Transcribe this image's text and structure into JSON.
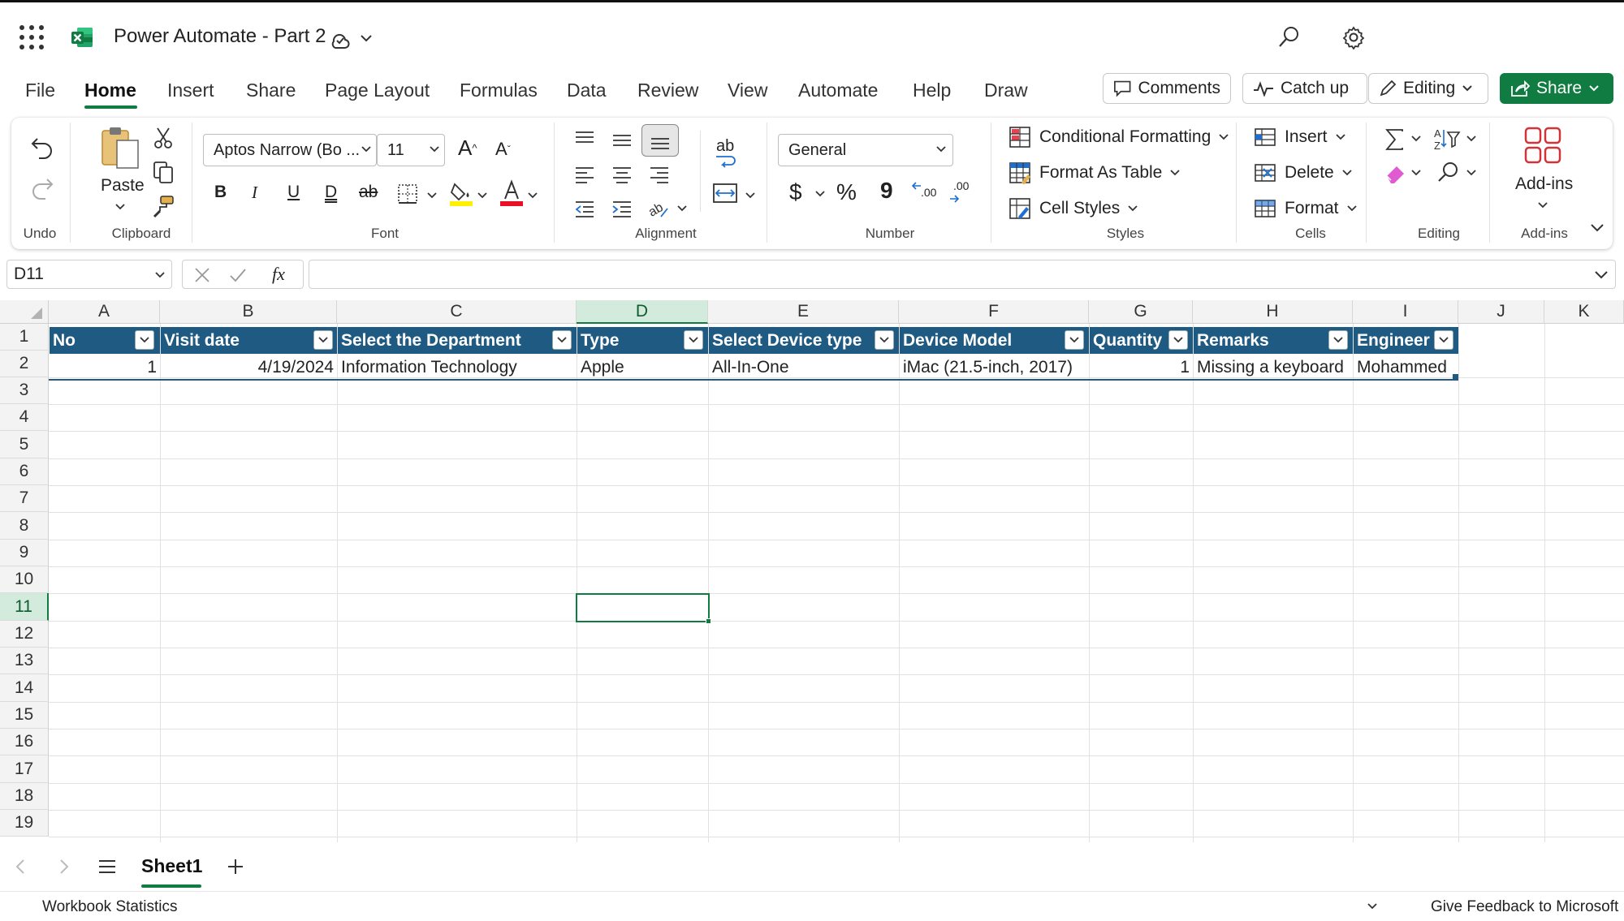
{
  "app": {
    "title": "Power Automate - Part 2"
  },
  "colors": {
    "accent": "#107c41",
    "table_header": "#1f5a82"
  },
  "tabs": [
    {
      "label": "File"
    },
    {
      "label": "Home",
      "active": true
    },
    {
      "label": "Insert"
    },
    {
      "label": "Share"
    },
    {
      "label": "Page Layout"
    },
    {
      "label": "Formulas"
    },
    {
      "label": "Data"
    },
    {
      "label": "Review"
    },
    {
      "label": "View"
    },
    {
      "label": "Automate"
    },
    {
      "label": "Help"
    },
    {
      "label": "Draw"
    }
  ],
  "header_buttons": {
    "comments": "Comments",
    "catchup": "Catch up",
    "editing": "Editing",
    "share": "Share"
  },
  "ribbon": {
    "groups": {
      "undo": "Undo",
      "clipboard": "Clipboard",
      "font": "Font",
      "alignment": "Alignment",
      "number": "Number",
      "styles": "Styles",
      "cells": "Cells",
      "editing": "Editing",
      "addins": "Add-ins"
    },
    "paste_label": "Paste",
    "font_name": "Aptos Narrow (Bo ...",
    "font_size": "11",
    "number_format": "General",
    "conditional_formatting": "Conditional Formatting",
    "format_as_table": "Format As Table",
    "cell_styles": "Cell Styles",
    "insert": "Insert",
    "delete": "Delete",
    "format": "Format",
    "addins_label": "Add-ins",
    "bold_glyph": "B",
    "italic_glyph": "I",
    "underline_glyph": "U",
    "double_underline_glyph": "D",
    "strike_glyph": "ab",
    "dollar_glyph": "$",
    "percent_glyph": "%",
    "comma_glyph": "9",
    "inc_dec_glyph": ".00",
    "dec_dec_glyph": ".00",
    "wrap_glyph": "ab"
  },
  "formula_bar": {
    "name_box": "D11",
    "fx": "fx",
    "value": ""
  },
  "grid": {
    "columns": [
      "A",
      "B",
      "C",
      "D",
      "E",
      "F",
      "G",
      "H",
      "I",
      "J",
      "K"
    ],
    "rows": [
      "1",
      "2",
      "3",
      "4",
      "5",
      "6",
      "7",
      "8",
      "9",
      "10",
      "11",
      "12",
      "13",
      "14",
      "15",
      "16",
      "17",
      "18",
      "19"
    ],
    "selected_col": "D",
    "selected_row": "11"
  },
  "table": {
    "headers": [
      "No",
      "Visit date",
      "Select the Department",
      "Type",
      "Select Device type",
      "Device Model",
      "Quantity",
      "Remarks",
      "Engineer"
    ],
    "rows": [
      [
        "1",
        "4/19/2024",
        "Information Technology",
        "Apple",
        "All-In-One",
        "iMac (21.5-inch, 2017)",
        "1",
        "Missing a keyboard",
        "Mohammed"
      ]
    ]
  },
  "sheets": [
    {
      "label": "Sheet1",
      "active": true
    }
  ],
  "status": {
    "left": "Workbook Statistics",
    "right": "Give Feedback to Microsoft"
  }
}
